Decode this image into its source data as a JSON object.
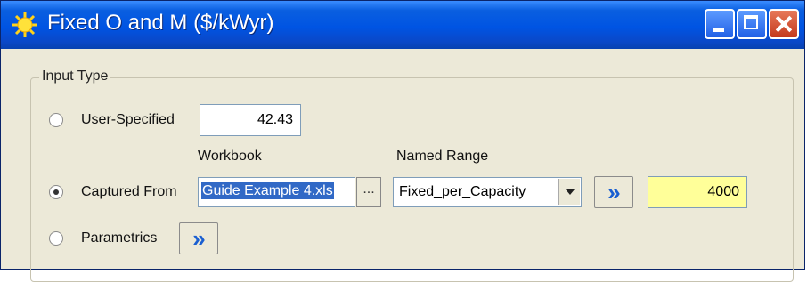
{
  "window": {
    "title": "Fixed O and M  ($/kWyr)"
  },
  "input_type": {
    "group_label": "Input Type",
    "user_specified": {
      "label": "User-Specified",
      "value": "42.43",
      "selected": false
    },
    "captured_from": {
      "label": "Captured From",
      "selected": true,
      "workbook_header": "Workbook",
      "workbook_value": "Guide Example 4.xls",
      "browse_label": "...",
      "named_range_header": "Named Range",
      "named_range_value": "Fixed_per_Capacity",
      "go_label": "»",
      "result_value": "4000"
    },
    "parametrics": {
      "label": "Parametrics",
      "go_label": "»",
      "selected": false
    }
  }
}
